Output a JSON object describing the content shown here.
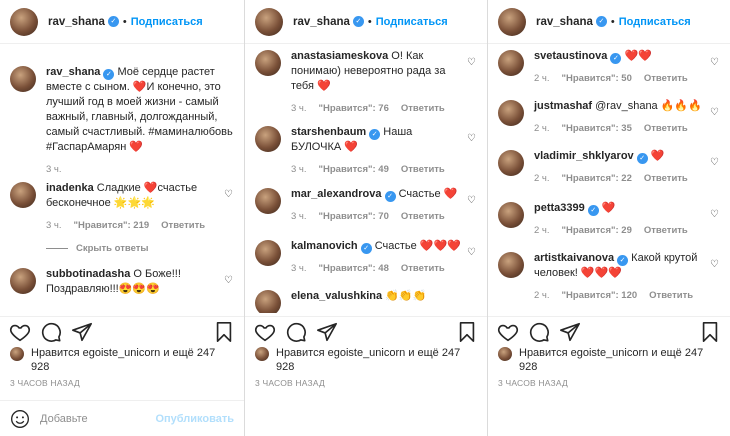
{
  "follow_label": "Подписаться",
  "left": {
    "header_user": "rav_shana",
    "caption": {
      "user": "rav_shana",
      "text": "Моё сердце растет вместе с сыном. ❤️И конечно, это лучший год в моей жизни - самый важный, главный, долгожданный, самый счастливый. #маминалюбовь #ГаспарАмарян ❤️",
      "time": "3 ч."
    },
    "comments": [
      {
        "user": "inadenka",
        "text": "Сладкие ❤️счастье бесконечное 🌟🌟🌟",
        "time": "3 ч.",
        "likes": "\"Нравится\": 219",
        "reply": "Ответить"
      },
      {
        "user": "subbotinadasha",
        "text": "О Боже!!! Поздравляю!!!😍😍😍",
        "time": "",
        "likes": "",
        "reply": ""
      }
    ],
    "hide_replies": "Скрыть ответы",
    "liked_by": "Нравится egoiste_unicorn и ещё 247 928",
    "time_ago": "3 ЧАСОВ НАЗАД",
    "add_comment_placeholder": "Добавьте",
    "publish_label": "Опубликовать"
  },
  "middle": {
    "header_user": "rav_shana",
    "comments": [
      {
        "user": "anastasiameskova",
        "text": "О! Как понимаю) невероятно рада за тебя ❤️",
        "time": "3 ч.",
        "likes": "\"Нравится\": 76",
        "reply": "Ответить"
      },
      {
        "user": "starshenbaum",
        "text": "Наша БУЛОЧКА ❤️",
        "time": "3 ч.",
        "likes": "\"Нравится\": 49",
        "reply": "Ответить"
      },
      {
        "user": "mar_alexandrova",
        "text": "Счастье ❤️",
        "time": "3 ч.",
        "likes": "\"Нравится\": 70",
        "reply": "Ответить"
      },
      {
        "user": "kalmanovich",
        "text": "Счастье ❤️❤️❤️",
        "time": "3 ч.",
        "likes": "\"Нравится\": 48",
        "reply": "Ответить"
      },
      {
        "user": "elena_valushkina",
        "text": "👏👏👏",
        "time": "",
        "likes": "",
        "reply": ""
      }
    ],
    "liked_by": "Нравится egoiste_unicorn и ещё 247 928",
    "time_ago": "3 ЧАСОВ НАЗАД"
  },
  "right": {
    "header_user": "rav_shana",
    "comments": [
      {
        "user": "svetaustinova",
        "text": "❤️❤️",
        "time": "2 ч.",
        "likes": "\"Нравится\": 50",
        "reply": "Ответить"
      },
      {
        "user": "justmashaf",
        "text": "@rav_shana 🔥🔥🔥",
        "time": "2 ч.",
        "likes": "\"Нравится\": 35",
        "reply": "Ответить"
      },
      {
        "user": "vladimir_shklyarov",
        "text": "❤️",
        "time": "2 ч.",
        "likes": "\"Нравится\": 22",
        "reply": "Ответить"
      },
      {
        "user": "petta3399",
        "text": "❤️",
        "time": "2 ч.",
        "likes": "\"Нравится\": 29",
        "reply": "Ответить"
      },
      {
        "user": "artistkaivanova",
        "text": "Какой крутой человек! ❤️❤️❤️",
        "time": "2 ч.",
        "likes": "\"Нравится\": 120",
        "reply": "Ответить"
      }
    ],
    "liked_by": "Нравится egoiste_unicorn и ещё 247 928",
    "time_ago": "3 ЧАСОВ НАЗАД"
  }
}
